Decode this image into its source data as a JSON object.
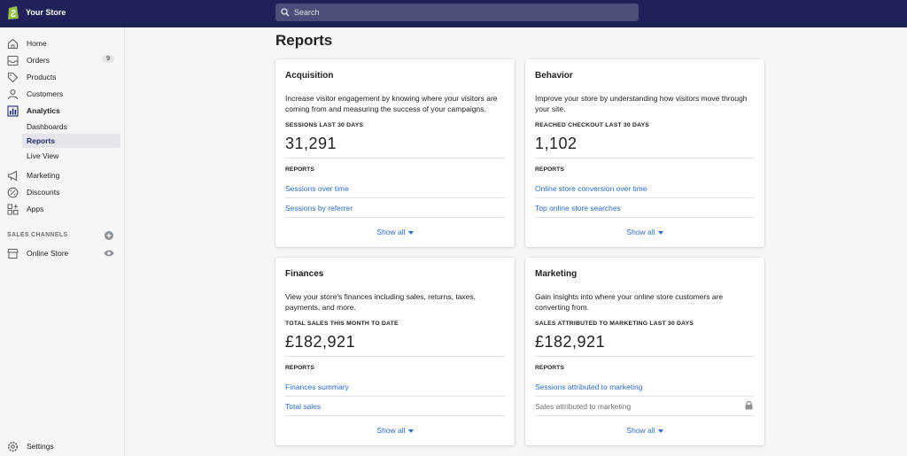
{
  "topbar": {
    "store_name": "Your Store",
    "search_placeholder": "Search"
  },
  "sidebar": {
    "home": "Home",
    "orders": "Orders",
    "orders_count": "9",
    "products": "Products",
    "customers": "Customers",
    "analytics": "Analytics",
    "analytics_sub": [
      "Dashboards",
      "Reports",
      "Live View"
    ],
    "marketing": "Marketing",
    "discounts": "Discounts",
    "apps": "Apps",
    "sales_channels_header": "SALES CHANNELS",
    "online_store": "Online Store",
    "settings": "Settings"
  },
  "page": {
    "title": "Reports"
  },
  "cards": [
    {
      "title": "Acquisition",
      "description": "Increase visitor engagement by knowing where your visitors are coming from and measuring the success of your campaigns.",
      "metric_label": "SESSIONS LAST 30 DAYS",
      "metric_value": "31,291",
      "reports_label": "REPORTS",
      "links": [
        "Sessions over time",
        "Sessions by referrer"
      ],
      "show_all": "Show all"
    },
    {
      "title": "Behavior",
      "description": "Improve your store by understanding how visitors move through your site.",
      "metric_label": "REACHED CHECKOUT LAST 30 DAYS",
      "metric_value": "1,102",
      "reports_label": "REPORTS",
      "links": [
        "Online store conversion over time",
        "Top online store searches"
      ],
      "show_all": "Show all"
    },
    {
      "title": "Finances",
      "description": "View your store's finances including sales, returns, taxes, payments, and more.",
      "metric_label": "TOTAL SALES THIS MONTH TO DATE",
      "metric_value": "£182,921",
      "reports_label": "REPORTS",
      "links": [
        "Finances summary",
        "Total sales"
      ],
      "show_all": "Show all"
    },
    {
      "title": "Marketing",
      "description": "Gain insights into where your online store customers are converting from.",
      "metric_label": "SALES ATTRIBUTED TO MARKETING LAST 30 DAYS",
      "metric_value": "£182,921",
      "reports_label": "REPORTS",
      "links": [
        "Sessions attributed to marketing",
        "Sales attributed to marketing"
      ],
      "show_all": "Show all"
    }
  ],
  "colors": {
    "topbar": "#1e2259",
    "link": "#2c6ecb",
    "active_nav": "#1f2b6e"
  }
}
